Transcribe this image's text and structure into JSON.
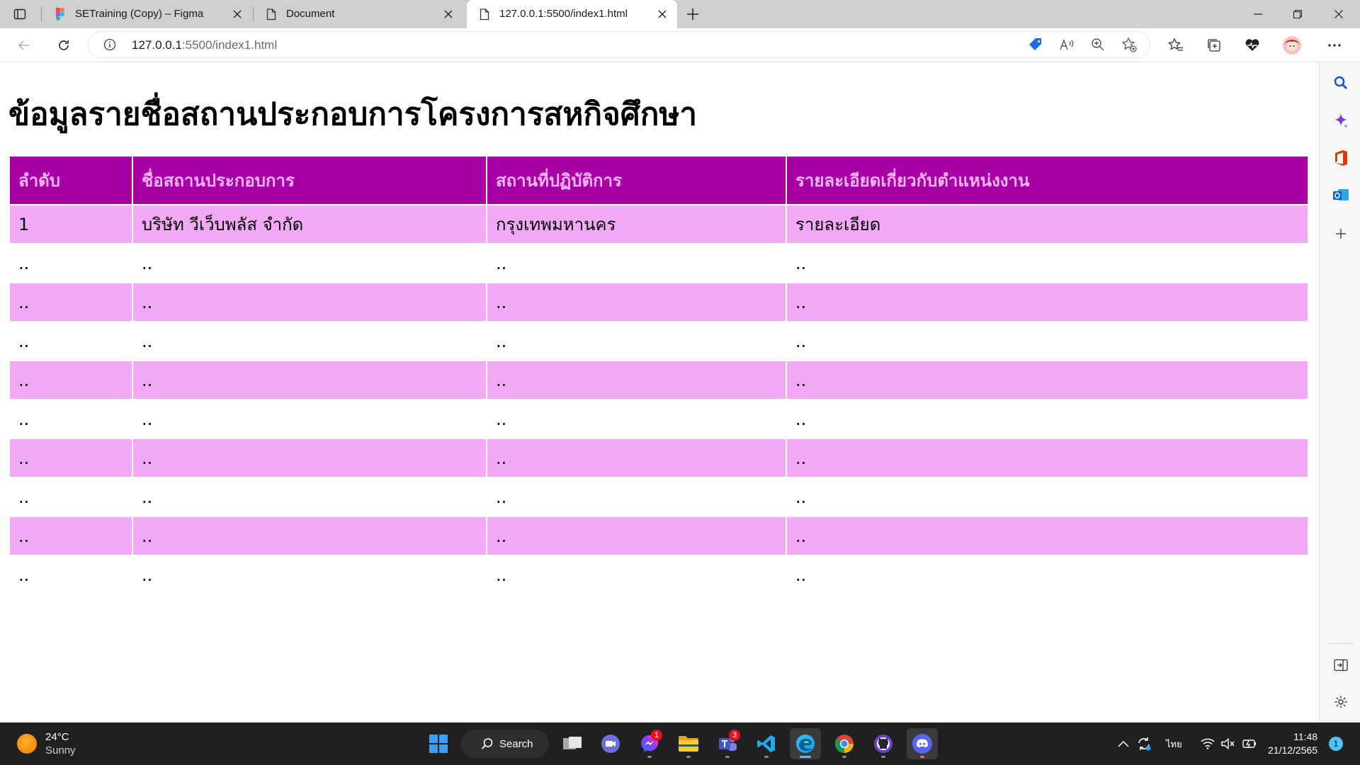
{
  "browser": {
    "tabs": [
      {
        "title": "SETraining (Copy) – Figma"
      },
      {
        "title": "Document"
      },
      {
        "title": "127.0.0.1:5500/index1.html"
      }
    ],
    "address": {
      "host": "127.0.0.1",
      "rest": ":5500/index1.html"
    }
  },
  "page": {
    "title": "ข้อมูลรายชื่อสถานประกอบการโครงการสหกิจศึกษา",
    "table": {
      "headers": [
        "ลำดับ",
        "ชื่อสถานประกอบการ",
        "สถานที่ปฏิบัติการ",
        "รายละเอียดเกี่ยวกับตำแหน่งงาน"
      ],
      "rows": [
        [
          "1",
          "บริษัท วีเว็บพลัส จำกัด",
          "กรุงเทพมหานคร",
          "รายละเอียด"
        ],
        [
          "..",
          "..",
          "..",
          ".."
        ],
        [
          "..",
          "..",
          "..",
          ".."
        ],
        [
          "..",
          "..",
          "..",
          ".."
        ],
        [
          "..",
          "..",
          "..",
          ".."
        ],
        [
          "..",
          "..",
          "..",
          ".."
        ],
        [
          "..",
          "..",
          "..",
          ".."
        ],
        [
          "..",
          "..",
          "..",
          ".."
        ],
        [
          "..",
          "..",
          "..",
          ".."
        ],
        [
          "..",
          "..",
          "..",
          ".."
        ]
      ]
    }
  },
  "taskbar": {
    "weather": {
      "temp": "24°C",
      "condition": "Sunny"
    },
    "search_label": "Search",
    "badges": {
      "messenger": "1",
      "teams": "3"
    },
    "language": "ไทย",
    "time": "11:48",
    "date": "21/12/2565",
    "notifications": "1"
  },
  "colors": {
    "header_bg": "#a600a6",
    "header_text": "#f4b6f4",
    "row_pink": "#f2a9f6"
  }
}
